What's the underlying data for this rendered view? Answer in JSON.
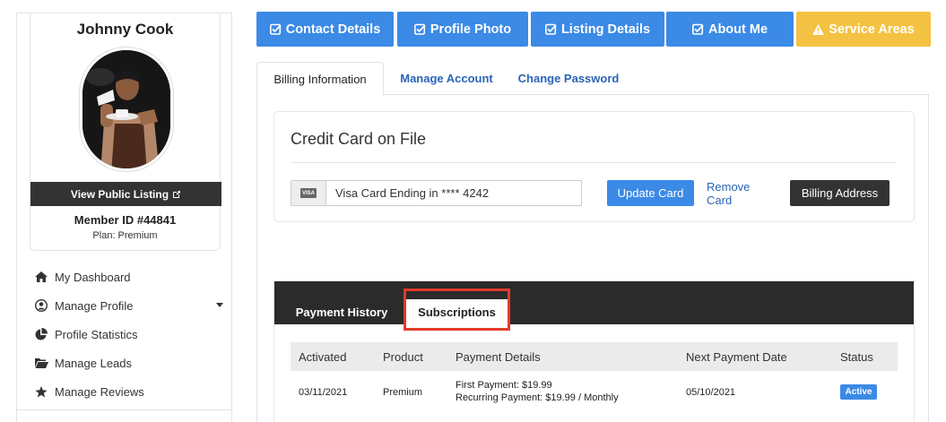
{
  "profile": {
    "name": "Johnny Cook",
    "view_public_listing": "View Public Listing",
    "member_id": "Member ID #44841",
    "plan": "Plan: Premium"
  },
  "sidebar": {
    "items": [
      {
        "label": "My Dashboard",
        "icon": "home-icon"
      },
      {
        "label": "Manage Profile",
        "icon": "user-circle-icon"
      },
      {
        "label": "Profile Statistics",
        "icon": "pie-chart-icon"
      },
      {
        "label": "Manage Leads",
        "icon": "folder-open-icon"
      },
      {
        "label": "Manage Reviews",
        "icon": "star-icon"
      }
    ]
  },
  "top_buttons": [
    {
      "label": "Contact Details",
      "icon": "check-square-icon"
    },
    {
      "label": "Profile Photo",
      "icon": "check-square-icon"
    },
    {
      "label": "Listing Details",
      "icon": "check-square-icon"
    },
    {
      "label": "About Me",
      "icon": "check-square-icon"
    },
    {
      "label": "Service Areas",
      "icon": "warning-icon"
    }
  ],
  "tabs": {
    "billing": "Billing Information",
    "account": "Manage Account",
    "password": "Change Password"
  },
  "credit_card": {
    "title": "Credit Card on File",
    "card_brand": "VISA",
    "card_text": "Visa Card Ending in **** 4242",
    "update_label": "Update Card",
    "remove_label": "Remove Card",
    "billing_label": "Billing Address"
  },
  "subscriptions": {
    "tab_history": "Payment History",
    "tab_subscriptions": "Subscriptions",
    "columns": [
      "Activated",
      "Product",
      "Payment Details",
      "Next Payment Date",
      "Status"
    ],
    "rows": [
      {
        "activated": "03/11/2021",
        "product": "Premium",
        "first_payment": "First Payment: $19.99",
        "recurring_payment": "Recurring Payment: $19.99 / Monthly",
        "next_payment": "05/10/2021",
        "status": "Active"
      }
    ]
  },
  "colors": {
    "primary_blue": "#3b8ae6",
    "warning_yellow": "#f4c242",
    "dark": "#333333",
    "link_blue": "#2a64b7",
    "highlight_red": "#e23b2a"
  }
}
